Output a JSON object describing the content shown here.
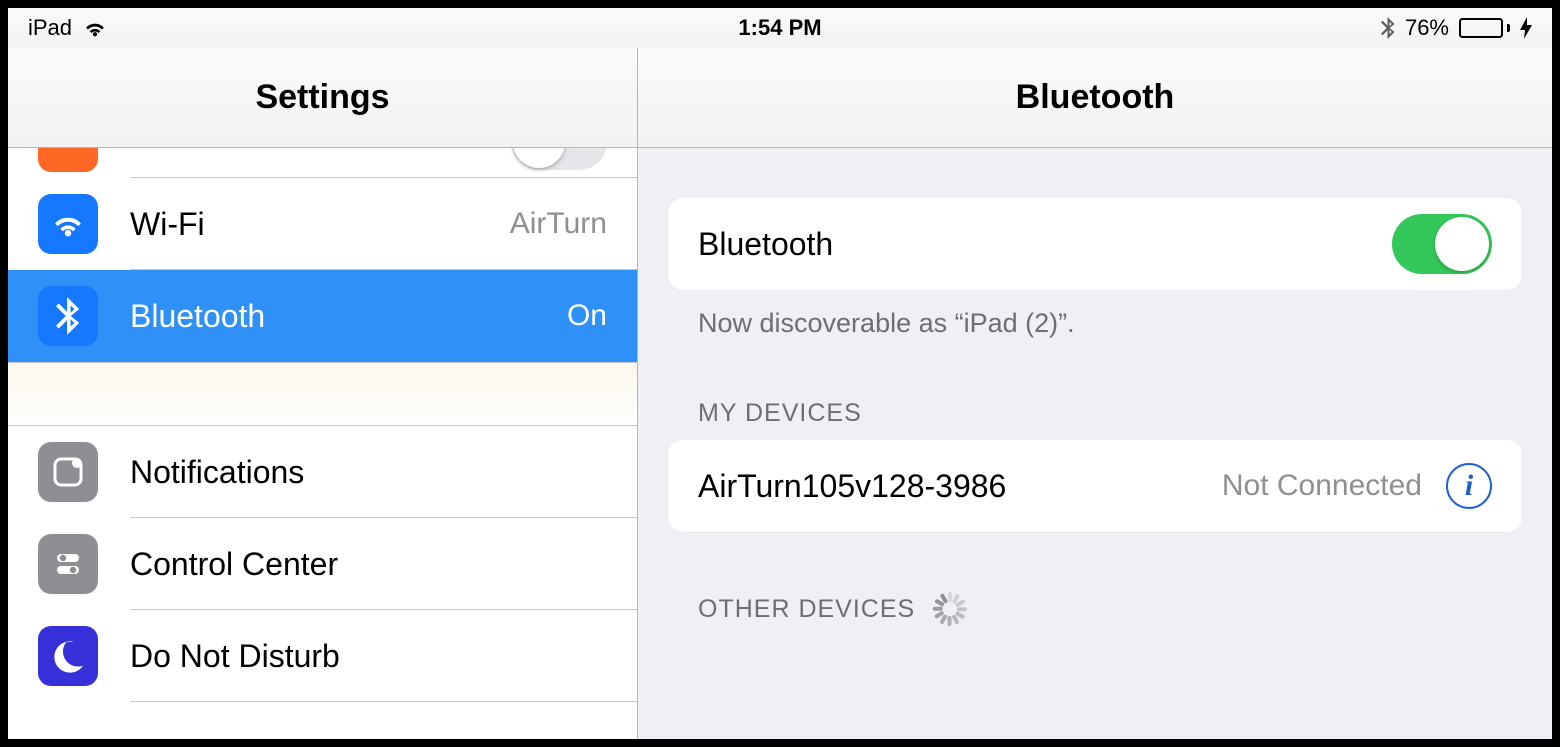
{
  "status": {
    "device_label": "iPad",
    "time": "1:54 PM",
    "battery_percent": "76%"
  },
  "sidebar": {
    "title": "Settings",
    "items": {
      "wifi": {
        "label": "Wi-Fi",
        "value": "AirTurn"
      },
      "bluetooth": {
        "label": "Bluetooth",
        "value": "On"
      },
      "notifications": {
        "label": "Notifications"
      },
      "control_center": {
        "label": "Control Center"
      },
      "dnd": {
        "label": "Do Not Disturb"
      }
    }
  },
  "detail": {
    "title": "Bluetooth",
    "toggle_label": "Bluetooth",
    "discoverable_text": "Now discoverable as “iPad (2)”.",
    "my_devices_header": "MY DEVICES",
    "other_devices_header": "OTHER DEVICES",
    "devices": [
      {
        "name": "AirTurn105v128-3986",
        "status": "Not Connected"
      }
    ]
  }
}
